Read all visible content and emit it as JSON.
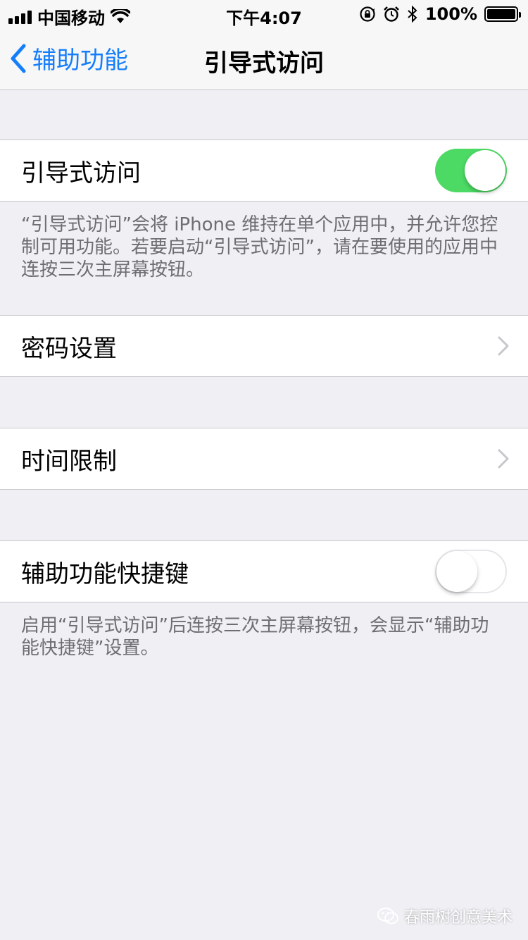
{
  "status_bar": {
    "carrier": "中国移动",
    "time": "下午4:07",
    "battery_percent": "100%",
    "icons": [
      "signal-icon",
      "wifi-icon",
      "rotation-lock-icon",
      "alarm-icon",
      "bluetooth-icon",
      "battery-icon"
    ]
  },
  "nav": {
    "back_label": "辅助功能",
    "title": "引导式访问"
  },
  "sections": {
    "guided_access": {
      "label": "引导式访问",
      "enabled": true,
      "footer": "“引导式访问”会将 iPhone 维持在单个应用中，并允许您控制可用功能。若要启动“引导式访问”，请在要使用的应用中连按三次主屏幕按钮。"
    },
    "passcode": {
      "label": "密码设置"
    },
    "time_limits": {
      "label": "时间限制"
    },
    "accessibility_shortcut": {
      "label": "辅助功能快捷键",
      "enabled": false,
      "footer": "启用“引导式访问”后连按三次主屏幕按钮，会显示“辅助功能快捷键”设置。"
    }
  },
  "watermark": {
    "text": "春雨树创意美术"
  },
  "colors": {
    "accent": "#157efb",
    "toggle_on": "#4cd964",
    "background": "#efeff4",
    "separator": "#c8c7cc",
    "footer_text": "#6d6d72"
  }
}
